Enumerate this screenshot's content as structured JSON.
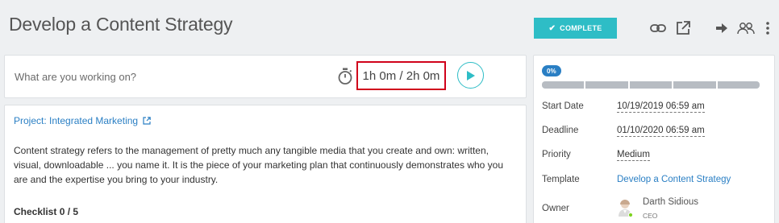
{
  "task": {
    "title": "Develop a Content Strategy"
  },
  "header": {
    "complete_label": "COMPLETE",
    "icons": [
      "link-icon",
      "external-link-icon",
      "arrow-right-icon",
      "users-icon",
      "more-vertical-icon"
    ]
  },
  "timer": {
    "placeholder": "What are you working on?",
    "time_display": "1h 0m / 2h 0m"
  },
  "description": {
    "project_link": "Project: Integrated Marketing",
    "text": "Content strategy refers to the management of pretty much any tangible media that you create and own: written, visual, downloadable ... you name it. It is the piece of your marketing plan that continuously demonstrates who you are and the expertise you bring to your industry.",
    "checklist_label": "Checklist 0 / 5"
  },
  "sidebar": {
    "progress": {
      "label": "0%",
      "value": 0,
      "segments": 5
    },
    "start_date": {
      "label": "Start Date",
      "value": "10/19/2019 06:59 am"
    },
    "deadline": {
      "label": "Deadline",
      "value": "01/10/2020 06:59 am"
    },
    "priority": {
      "label": "Priority",
      "value": "Medium"
    },
    "template": {
      "label": "Template",
      "value": "Develop a Content Strategy"
    },
    "owner": {
      "label": "Owner",
      "name": "Darth Sidious",
      "role": "CEO"
    }
  },
  "colors": {
    "accent": "#2ebdc6",
    "link": "#2a7fc4",
    "highlight": "#d0021b",
    "online": "#7ed321"
  }
}
